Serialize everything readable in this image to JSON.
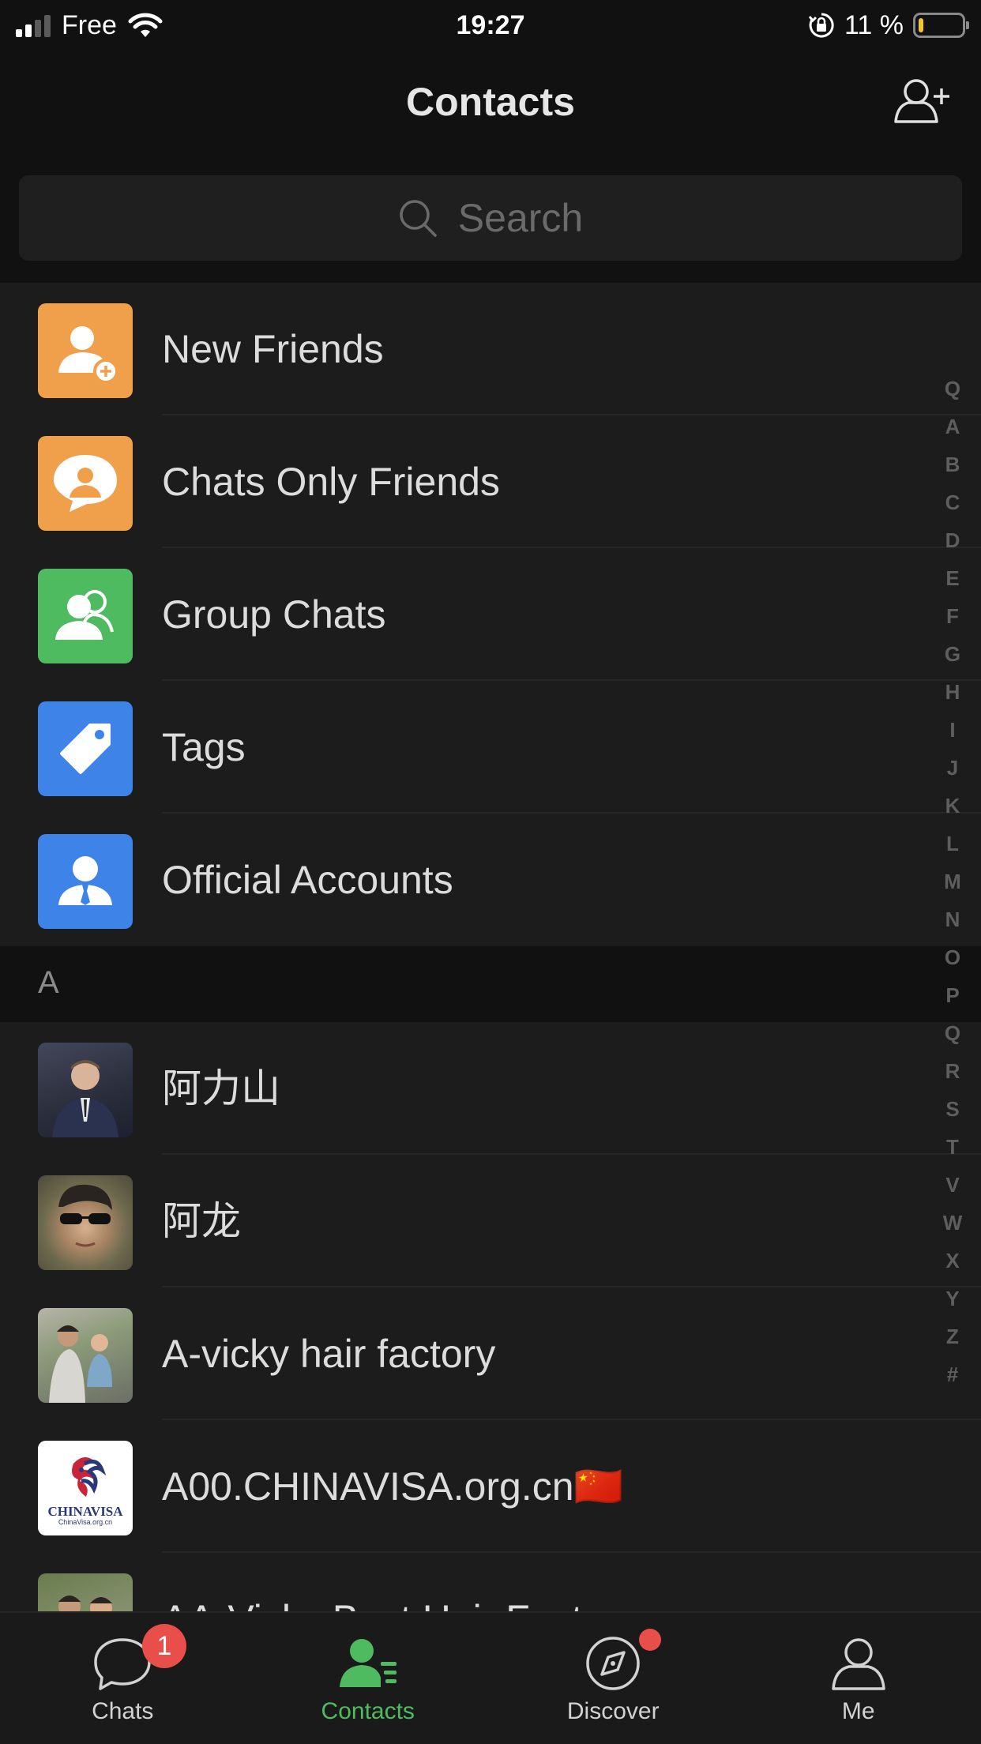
{
  "status_bar": {
    "carrier": "Free",
    "time": "19:27",
    "battery_percent": "11 %",
    "battery_level": 0.11
  },
  "header": {
    "title": "Contacts",
    "add_icon": "add-contact-icon"
  },
  "search": {
    "placeholder": "Search",
    "icon": "search-icon"
  },
  "function_items": [
    {
      "label": "New Friends",
      "icon": "new-friends-icon",
      "color": "#f0a04b"
    },
    {
      "label": "Chats Only Friends",
      "icon": "chats-only-friends-icon",
      "color": "#f0a04b"
    },
    {
      "label": "Group Chats",
      "icon": "group-chats-icon",
      "color": "#4fbb61"
    },
    {
      "label": "Tags",
      "icon": "tag-icon",
      "color": "#3e84e8"
    },
    {
      "label": "Official Accounts",
      "icon": "official-accounts-icon",
      "color": "#3e84e8"
    }
  ],
  "sections": [
    {
      "letter": "A",
      "contacts": [
        {
          "name": "阿力山"
        },
        {
          "name": "阿龙"
        },
        {
          "name": "A-vicky hair factory"
        },
        {
          "name": "A00.CHINAVISA.org.cn🇨🇳",
          "avatar_text": "CHINAVISA",
          "avatar_subtext": "ChinaVisa.org.cn"
        },
        {
          "name": "AA-Vicky Best Hair Factory"
        }
      ]
    }
  ],
  "alpha_index": [
    "Q",
    "A",
    "B",
    "C",
    "D",
    "E",
    "F",
    "G",
    "H",
    "I",
    "J",
    "K",
    "L",
    "M",
    "N",
    "O",
    "P",
    "Q",
    "R",
    "S",
    "T",
    "V",
    "W",
    "X",
    "Y",
    "Z",
    "#"
  ],
  "tab_bar": {
    "tabs": [
      {
        "label": "Chats",
        "icon": "chats-icon",
        "badge": "1"
      },
      {
        "label": "Contacts",
        "icon": "contacts-icon",
        "active": true
      },
      {
        "label": "Discover",
        "icon": "discover-icon",
        "dot": true
      },
      {
        "label": "Me",
        "icon": "me-icon"
      }
    ]
  },
  "colors": {
    "accent_green": "#4fbb61",
    "badge_red": "#e94f4a",
    "background": "#111111",
    "row_background": "#1c1c1c"
  }
}
